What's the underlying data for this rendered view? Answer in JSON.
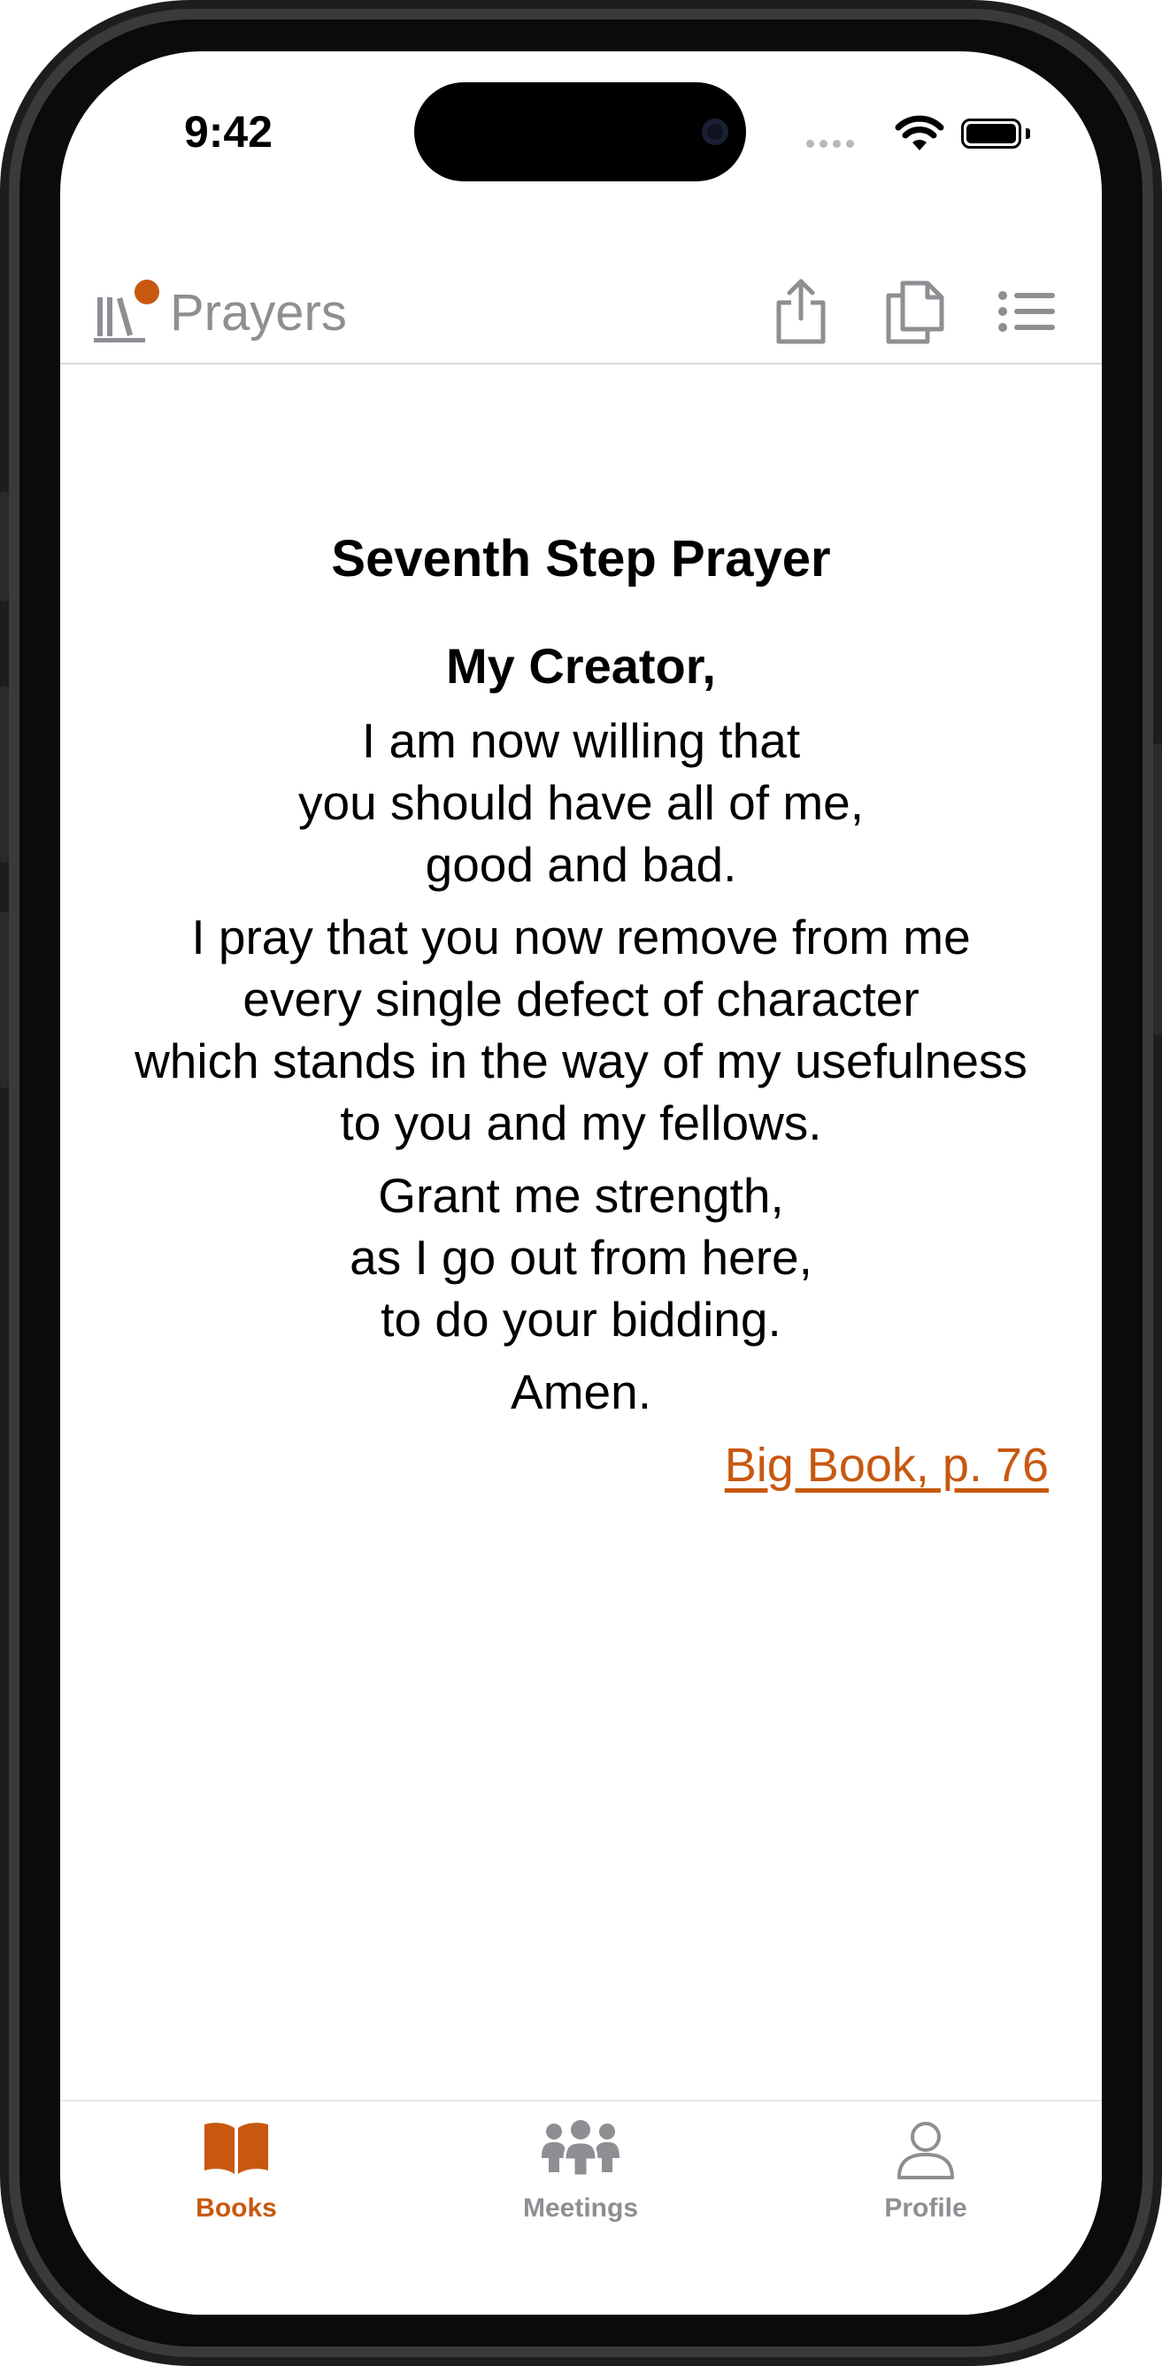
{
  "status_bar": {
    "time": "9:42"
  },
  "header": {
    "title": "Prayers",
    "accent_color": "#c8580f"
  },
  "prayer": {
    "title": "Seventh Step Prayer",
    "salutation": "My Creator,",
    "stanza1": [
      "I am now willing that",
      "you should have all of me,",
      "good and bad."
    ],
    "stanza2": [
      "I pray that you now remove from me",
      "every single defect of character",
      "which stands in the way of my usefulness",
      "to you and my fellows."
    ],
    "stanza3": [
      "Grant me strength,",
      "as I go out from here,",
      "to do your bidding."
    ],
    "closing": "Amen.",
    "source_link": "Big Book, p. 76"
  },
  "tab_bar": {
    "tabs": [
      {
        "label": "Books",
        "icon": "open-book-icon",
        "active": true
      },
      {
        "label": "Meetings",
        "icon": "people-group-icon",
        "active": false
      },
      {
        "label": "Profile",
        "icon": "person-icon",
        "active": false
      }
    ],
    "active_color": "#c8580f",
    "inactive_color": "#8e8e93"
  }
}
